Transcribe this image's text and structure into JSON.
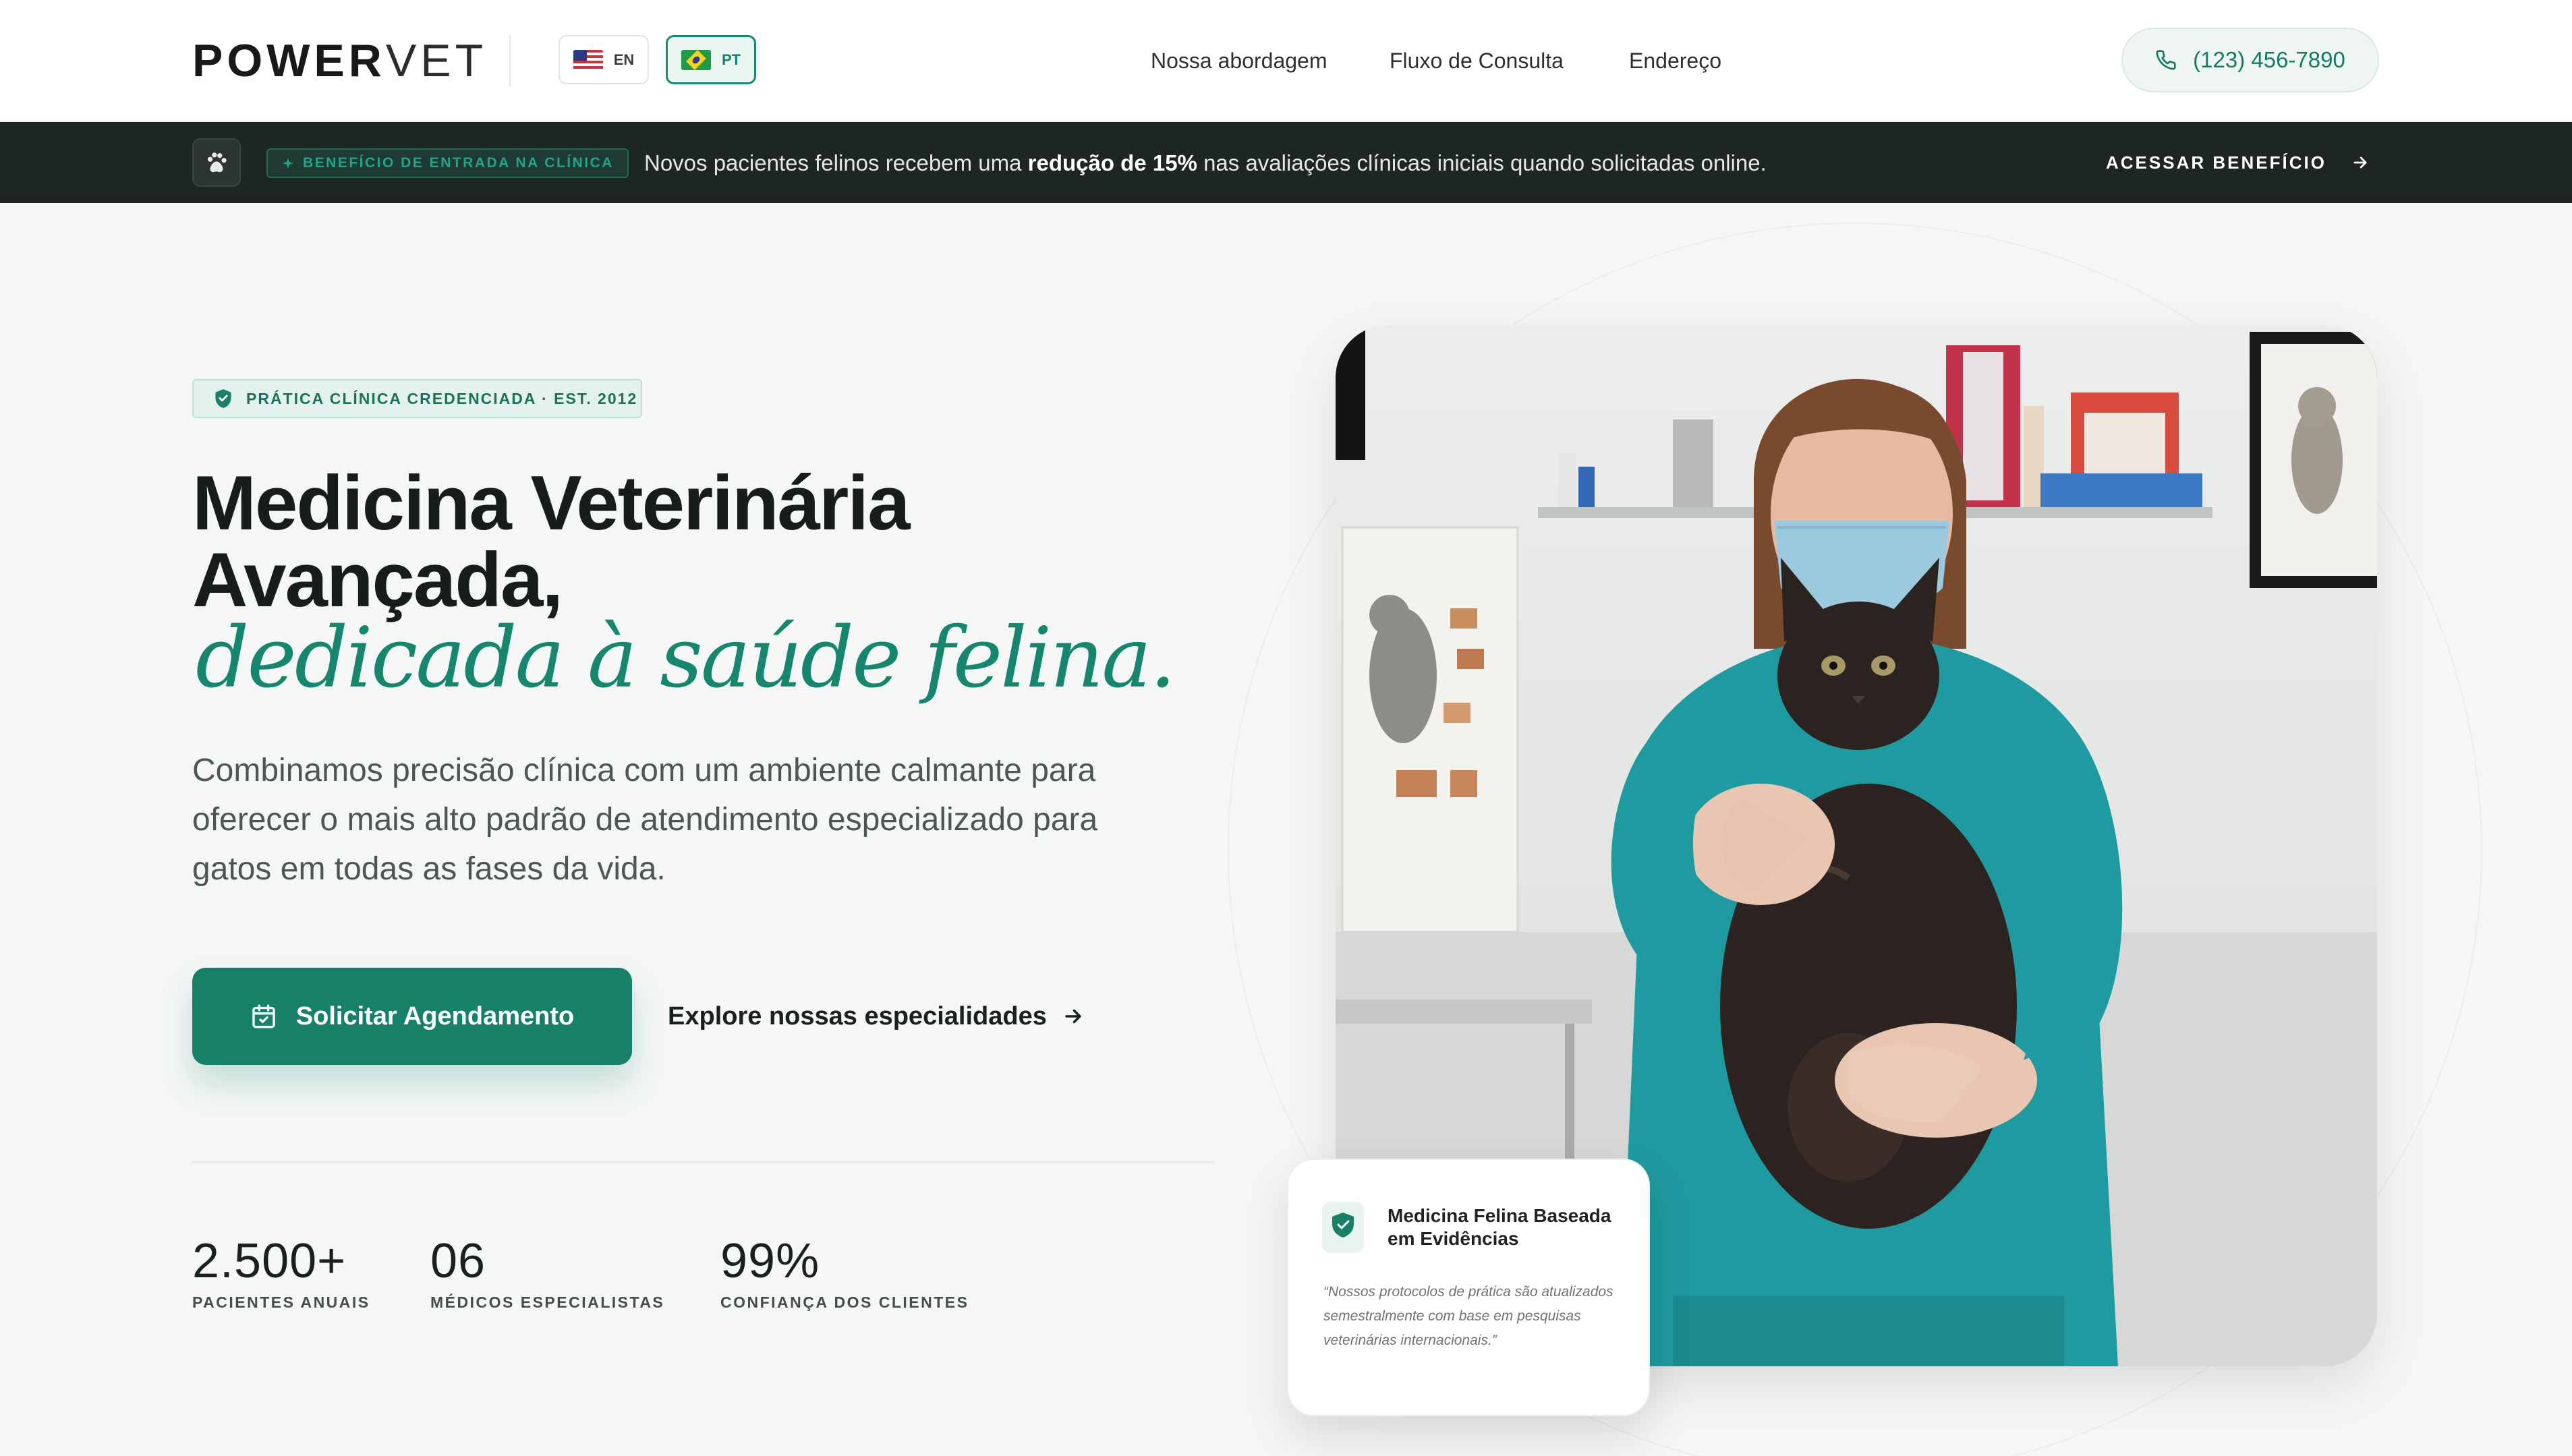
{
  "brand": {
    "logo_bold": "POWER",
    "logo_light": "VET"
  },
  "languages": [
    {
      "code": "EN",
      "flag": "us-flag-icon",
      "active": false
    },
    {
      "code": "PT",
      "flag": "brazil-flag-icon",
      "active": true
    }
  ],
  "nav": {
    "items": [
      "Nossa abordagem",
      "Fluxo de Consulta",
      "Endereço"
    ]
  },
  "phone": {
    "label": "(123) 456-7890",
    "icon": "phone-icon"
  },
  "promo": {
    "badge": "BENEFÍCIO DE ENTRADA NA CLÍNICA",
    "text_before": "Novos pacientes felinos recebem uma ",
    "text_bold": "redução de 15%",
    "text_after": " nas avaliações clínicas iniciais quando solicitadas online.",
    "cta": "ACESSAR BENEFÍCIO"
  },
  "hero": {
    "badge": "PRÁTICA CLÍNICA CREDENCIADA · EST. 2012",
    "title_line1": "Medicina Veterinária",
    "title_line2": "Avançada,",
    "title_italic": "dedicada à saúde felina.",
    "description": "Combinamos precisão clínica com um ambiente calmante para oferecer o mais alto padrão de atendimento especializado para gatos em todas as fases da vida.",
    "primary_cta": "Solicitar Agendamento",
    "secondary_cta": "Explore nossas especialidades"
  },
  "stats": [
    {
      "value": "2.500+",
      "label": "PACIENTES ANUAIS"
    },
    {
      "value": "06",
      "label": "MÉDICOS ESPECIALISTAS"
    },
    {
      "value": "99%",
      "label": "CONFIANÇA DOS CLIENTES"
    }
  ],
  "evidence_card": {
    "title": "Medicina Felina Baseada em Evidências",
    "quote": "“Nossos protocolos de prática são atualizados semestralmente com base em pesquisas veterinárias internacionais.”"
  },
  "colors": {
    "accent": "#168068",
    "accent_light": "#e3f2ed",
    "promo_bg": "#1e2623",
    "scrubs": "#1f9aa0"
  }
}
